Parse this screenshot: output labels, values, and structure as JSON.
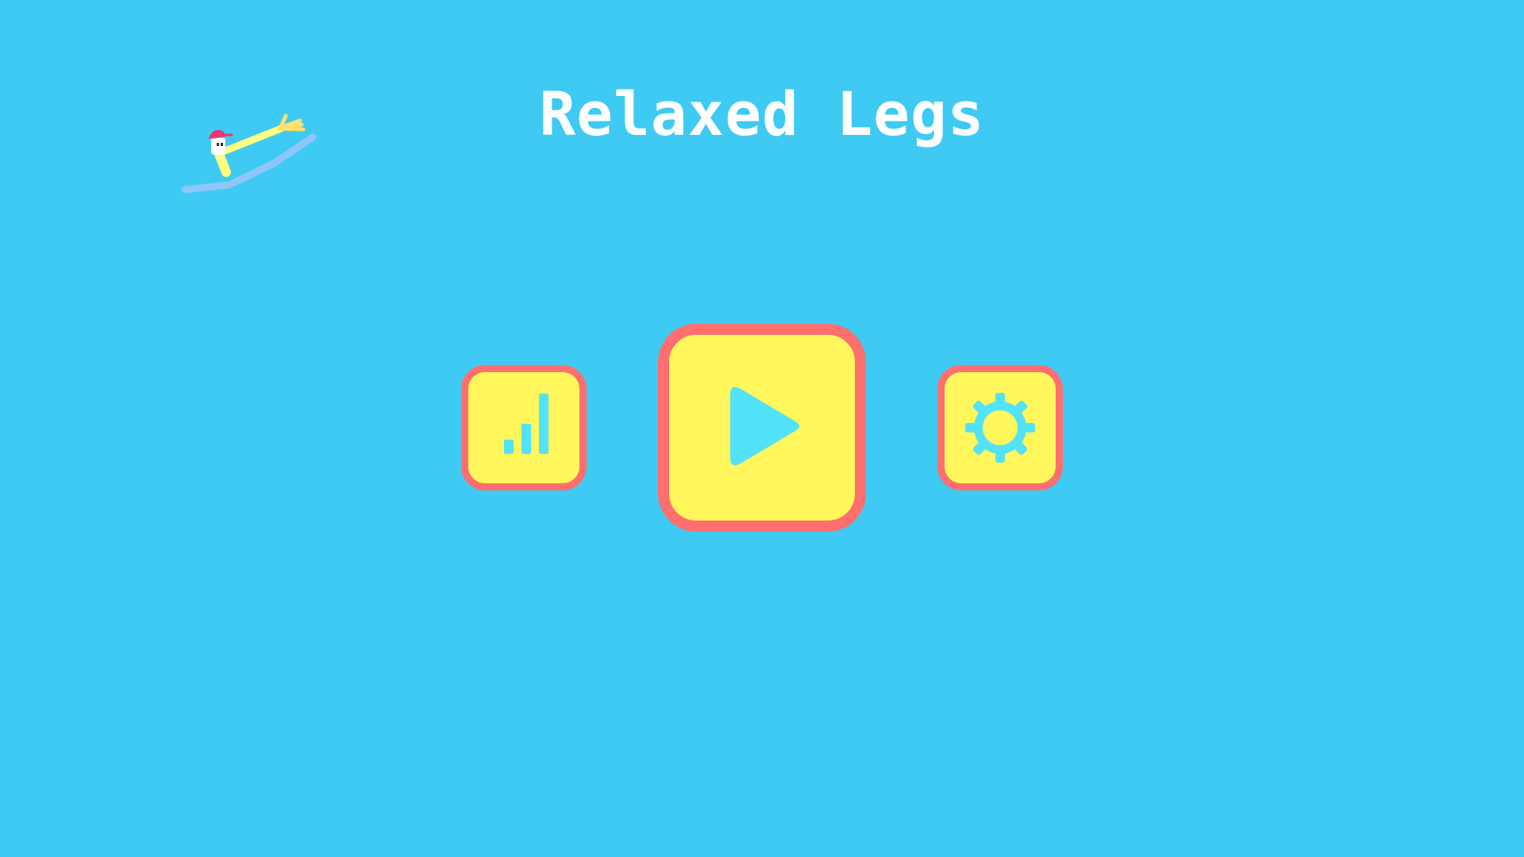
{
  "game": {
    "title": "Relaxed Legs"
  },
  "colors": {
    "background": "#3fcaf3",
    "button_fill": "#fff75c",
    "button_border": "#ff6f6f",
    "icon": "#52e2fa",
    "title_text": "#ffffff",
    "mascot_legs": "#8ec6fb",
    "mascot_body": "#ffff82",
    "mascot_cap": "#e8386d"
  },
  "menu": {
    "buttons": [
      {
        "id": "stats",
        "icon": "bar-chart-icon",
        "size": "small"
      },
      {
        "id": "play",
        "icon": "play-icon",
        "size": "large"
      },
      {
        "id": "settings",
        "icon": "gear-icon",
        "size": "small"
      }
    ]
  },
  "mascot": {
    "icon": "ragdoll-character-icon"
  }
}
